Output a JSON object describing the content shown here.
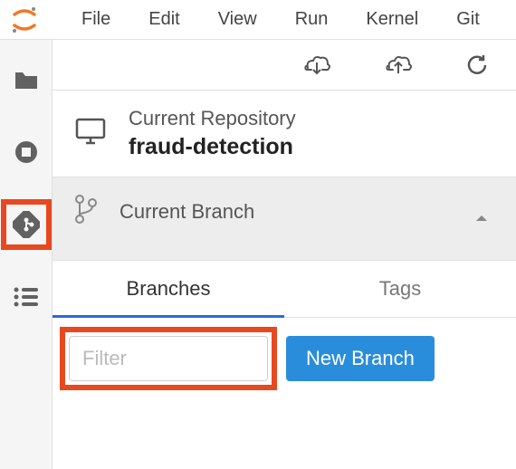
{
  "menu": {
    "items": [
      "File",
      "Edit",
      "View",
      "Run",
      "Kernel",
      "Git"
    ]
  },
  "repo": {
    "label": "Current Repository",
    "name": "fraud-detection"
  },
  "branch": {
    "label": "Current Branch"
  },
  "tabs": {
    "branches": "Branches",
    "tags": "Tags"
  },
  "filter": {
    "placeholder": "Filter"
  },
  "buttons": {
    "new_branch": "New Branch"
  }
}
